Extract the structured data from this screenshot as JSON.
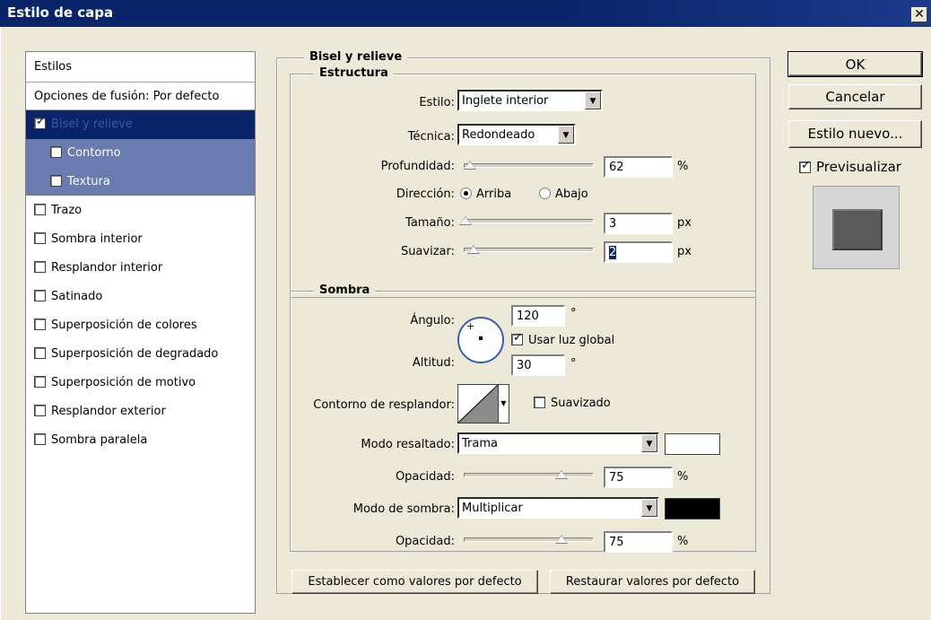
{
  "window": {
    "title": "Estilo de capa",
    "close_glyph": "✕"
  },
  "sidebar": {
    "header": "Estilos",
    "blend_options": "Opciones de fusión: Por defecto",
    "items": [
      {
        "label": "Bisel y relieve",
        "checked": true
      },
      {
        "label": "Contorno",
        "checked": false
      },
      {
        "label": "Textura",
        "checked": false
      },
      {
        "label": "Trazo",
        "checked": false
      },
      {
        "label": "Sombra interior",
        "checked": false
      },
      {
        "label": "Resplandor interior",
        "checked": false
      },
      {
        "label": "Satinado",
        "checked": false
      },
      {
        "label": "Superposición de colores",
        "checked": false
      },
      {
        "label": "Superposición de degradado",
        "checked": false
      },
      {
        "label": "Superposición de motivo",
        "checked": false
      },
      {
        "label": "Resplandor exterior",
        "checked": false
      },
      {
        "label": "Sombra paralela",
        "checked": false
      }
    ]
  },
  "bevel": {
    "title": "Bisel y relieve",
    "structure": {
      "title": "Estructura",
      "style_label": "Estilo:",
      "style_value": "Inglete interior",
      "technique_label": "Técnica:",
      "technique_value": "Redondeado",
      "depth_label": "Profundidad:",
      "depth_value": "62",
      "depth_unit": "%",
      "direction_label": "Dirección:",
      "direction_up": "Arriba",
      "direction_down": "Abajo",
      "size_label": "Tamaño:",
      "size_value": "3",
      "size_unit": "px",
      "soften_label": "Suavizar:",
      "soften_value": "2",
      "soften_unit": "px"
    },
    "shading": {
      "title": "Sombra",
      "angle_label": "Ángulo:",
      "angle_value": "120",
      "angle_unit": "°",
      "global_light_label": "Usar luz global",
      "altitude_label": "Altitud:",
      "altitude_value": "30",
      "altitude_unit": "°",
      "gloss_contour_label": "Contorno de resplandor:",
      "antialiased_label": "Suavizado",
      "highlight_mode_label": "Modo resaltado:",
      "highlight_mode_value": "Trama",
      "highlight_color": "#ffffff",
      "highlight_opacity_label": "Opacidad:",
      "highlight_opacity_value": "75",
      "highlight_opacity_unit": "%",
      "shadow_mode_label": "Modo de sombra:",
      "shadow_mode_value": "Multiplicar",
      "shadow_color": "#000000",
      "shadow_opacity_label": "Opacidad:",
      "shadow_opacity_value": "75",
      "shadow_opacity_unit": "%"
    },
    "make_default": "Establecer como valores por defecto",
    "reset_default": "Restaurar valores por defecto"
  },
  "actions": {
    "ok": "OK",
    "cancel": "Cancelar",
    "new_style": "Estilo nuevo...",
    "preview_label": "Previsualizar"
  }
}
